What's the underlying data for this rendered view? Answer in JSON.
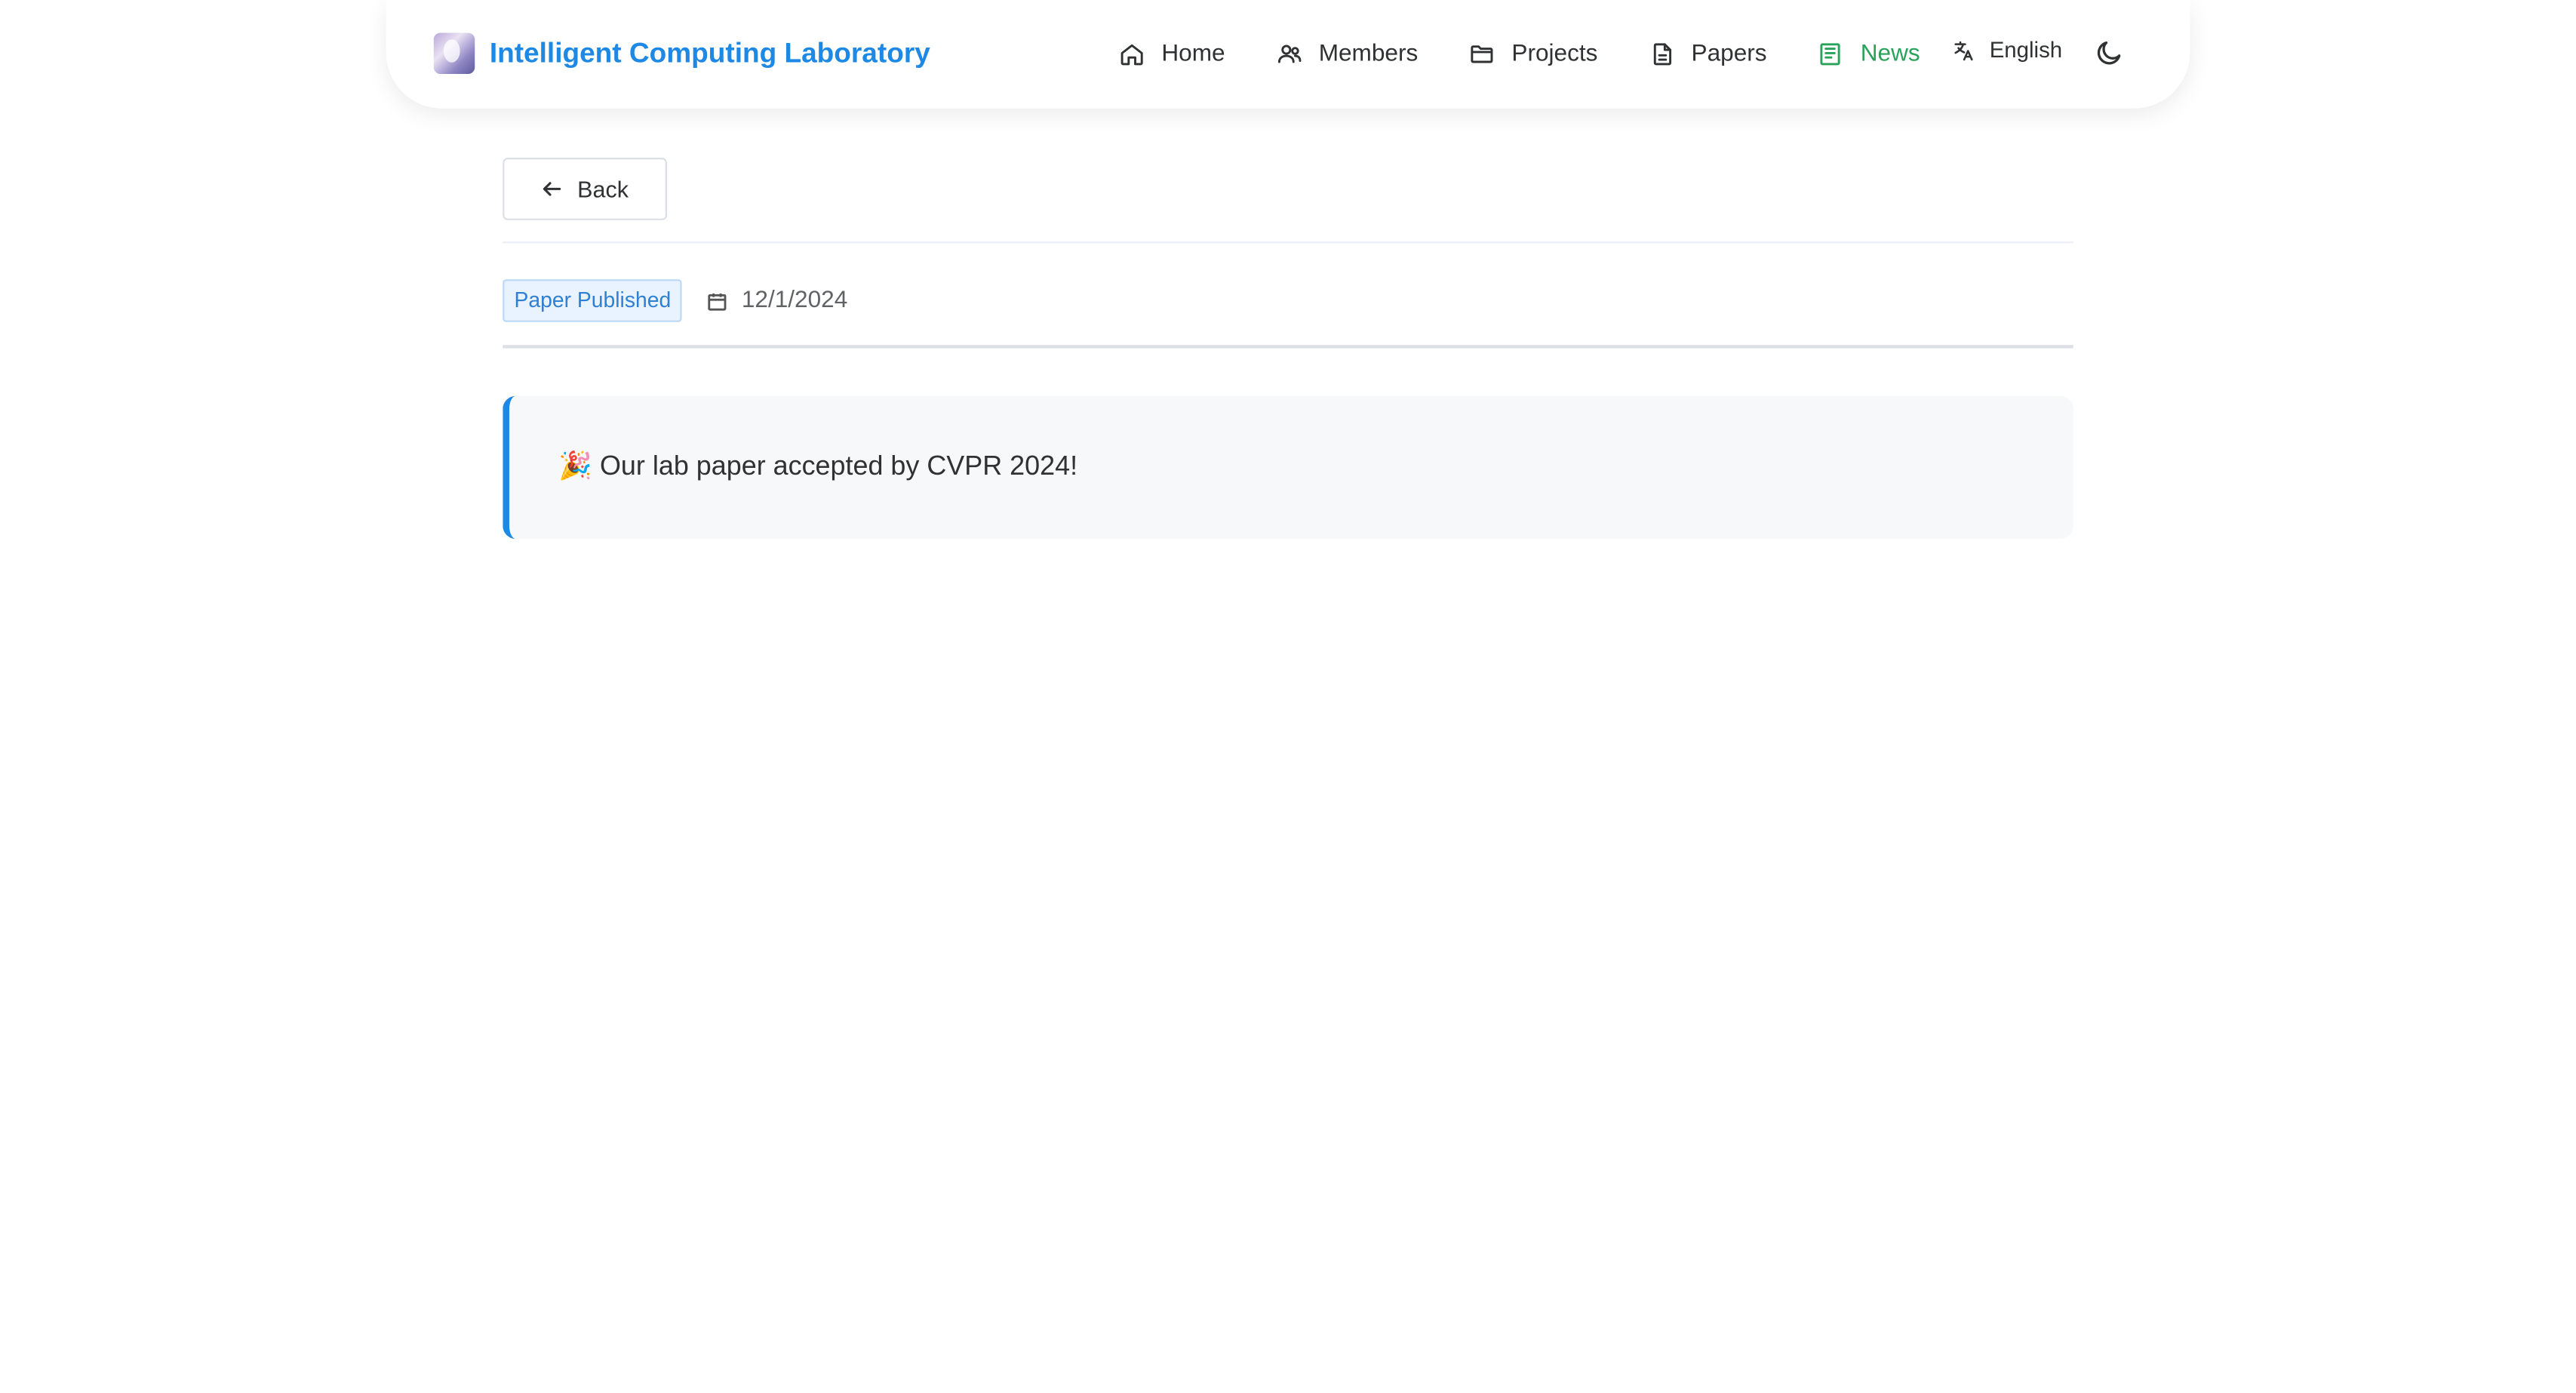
{
  "brand": {
    "title": "Intelligent Computing Laboratory",
    "logo_icon": "lab-logo",
    "color": "#1e88e5"
  },
  "nav": {
    "items": [
      {
        "label": "Home",
        "icon": "home-icon",
        "active": false
      },
      {
        "label": "Members",
        "icon": "users-icon",
        "active": false
      },
      {
        "label": "Projects",
        "icon": "folder-icon",
        "active": false
      },
      {
        "label": "Papers",
        "icon": "document-icon",
        "active": false
      },
      {
        "label": "News",
        "icon": "newspaper-icon",
        "active": true
      }
    ],
    "active_color": "#2aa35a",
    "language": {
      "label": "English",
      "icon": "translate-icon"
    },
    "theme_toggle_icon": "moon-icon"
  },
  "article": {
    "back_label": "Back",
    "back_icon": "arrow-left-icon",
    "tag": "Paper Published",
    "date_icon": "calendar-icon",
    "date": "12/1/2024",
    "content": "🎉 Our lab paper accepted by CVPR 2024!",
    "accent_color": "#1e88e5"
  }
}
